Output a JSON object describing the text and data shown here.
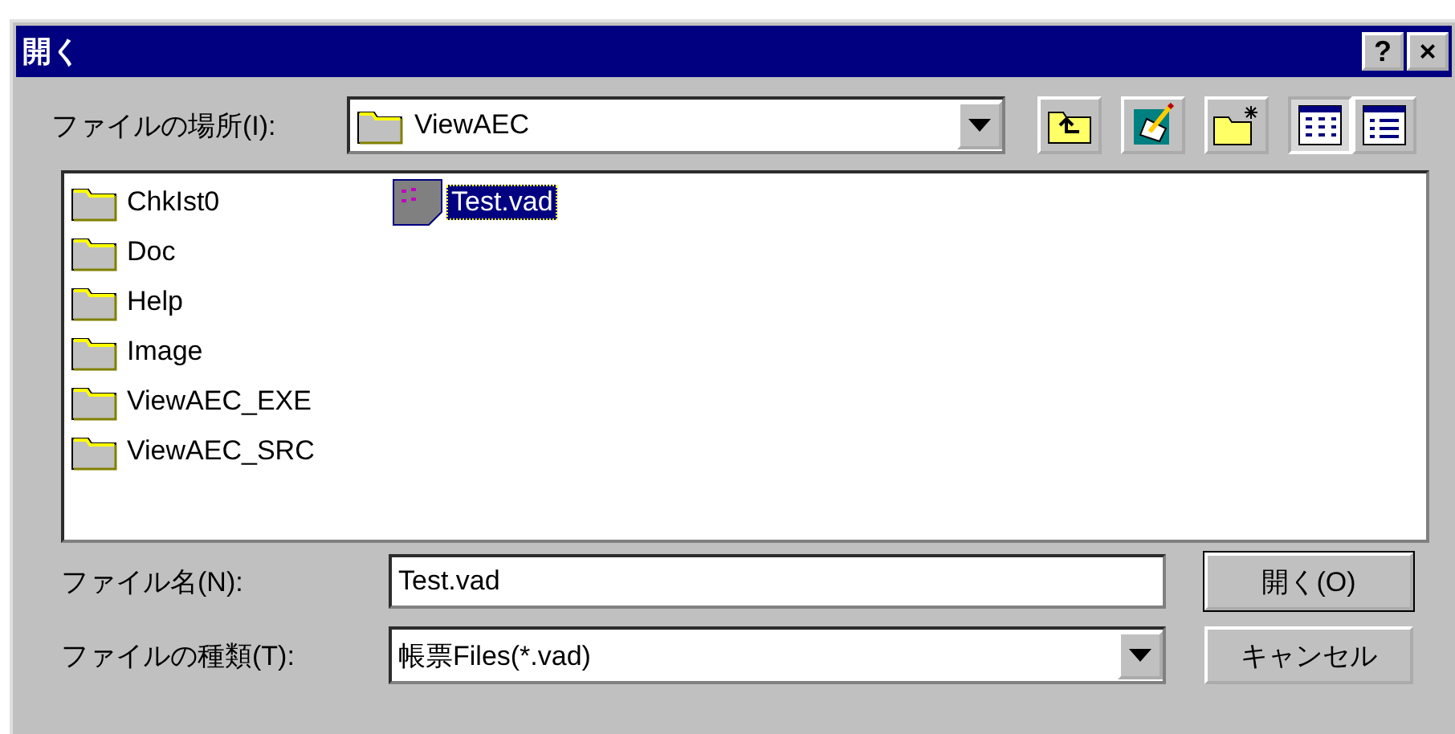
{
  "window": {
    "title": "開く",
    "title_buttons": [
      "?",
      "×"
    ]
  },
  "location": {
    "label": "ファイルの場所(I):",
    "value": "ViewAEC"
  },
  "toolbar": [
    {
      "kind": "up",
      "selected": false
    },
    {
      "kind": "desktop",
      "selected": false
    },
    {
      "kind": "newfolder",
      "selected": false
    },
    {
      "kind": "list",
      "selected": true
    },
    {
      "kind": "details",
      "selected": false
    }
  ],
  "files": [
    {
      "name": "ChkIst0",
      "kind": "folder",
      "selected": false
    },
    {
      "name": "Doc",
      "kind": "folder",
      "selected": false
    },
    {
      "name": "Help",
      "kind": "folder",
      "selected": false
    },
    {
      "name": "Image",
      "kind": "folder",
      "selected": false
    },
    {
      "name": "ViewAEC_EXE",
      "kind": "folder",
      "selected": false
    },
    {
      "name": "ViewAEC_SRC",
      "kind": "folder",
      "selected": false
    },
    {
      "name": "Test.vad",
      "kind": "file",
      "selected": true
    }
  ],
  "filename": {
    "label": "ファイル名(N):",
    "value": "Test.vad"
  },
  "filetype": {
    "label": "ファイルの種類(T):",
    "value": "帳票Files(*.vad)"
  },
  "buttons": [
    {
      "label": "開く(O)",
      "default": true
    },
    {
      "label": "キャンセル",
      "default": false
    }
  ]
}
